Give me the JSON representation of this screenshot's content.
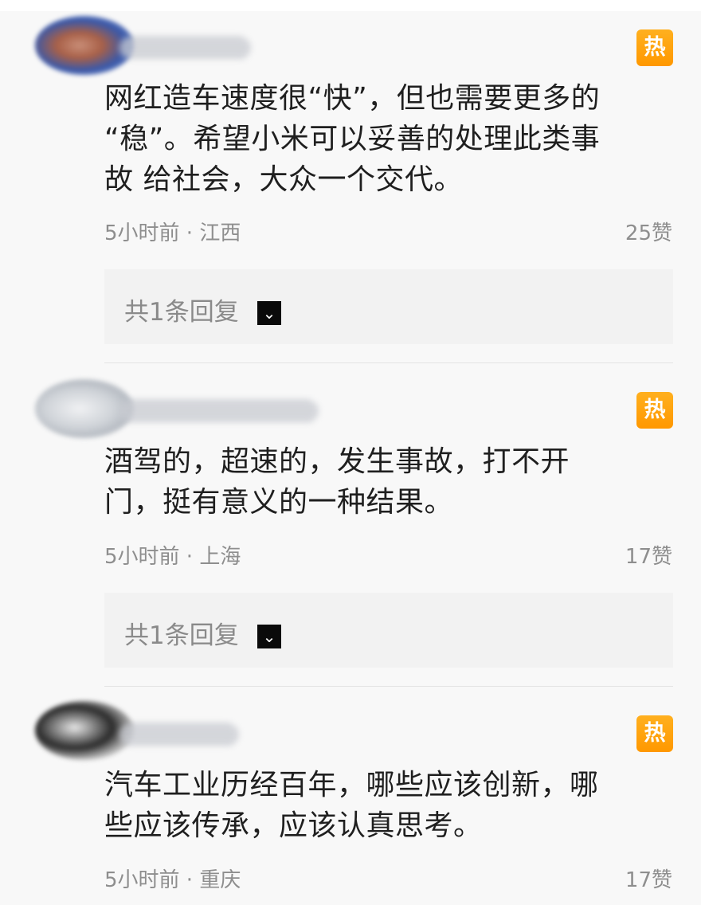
{
  "comments": [
    {
      "hot_badge": "热",
      "text_lines": [
        "网红造车速度很“快”，但也需要更多的",
        "“稳”。希望小米可以妥善的处理此类事",
        "故 给社会，大众一个交代。"
      ],
      "meta": "5小时前 · 江西",
      "likes": "25赞",
      "replies_label": "共1条回复",
      "replies_icon": "chevron-down-icon"
    },
    {
      "hot_badge": "热",
      "text_lines": [
        "酒驾的，超速的，发生事故，打不开",
        "门，挺有意义的一种结果。"
      ],
      "meta": "5小时前 · 上海",
      "likes": "17赞",
      "replies_label": "共1条回复",
      "replies_icon": "chevron-down-icon"
    },
    {
      "hot_badge": "热",
      "text_lines": [
        "汽车工业历经百年，哪些应该创新，哪",
        "些应该传承，应该认真思考。"
      ],
      "meta": "5小时前 · 重庆",
      "likes": "17赞"
    }
  ],
  "colors": {
    "hot_badge": "#ff9f0a",
    "body_text": "#1f1f1f",
    "meta_text": "#8e8e8e",
    "background": "#f8f8f8",
    "reply_box": "#f2f2f2"
  }
}
